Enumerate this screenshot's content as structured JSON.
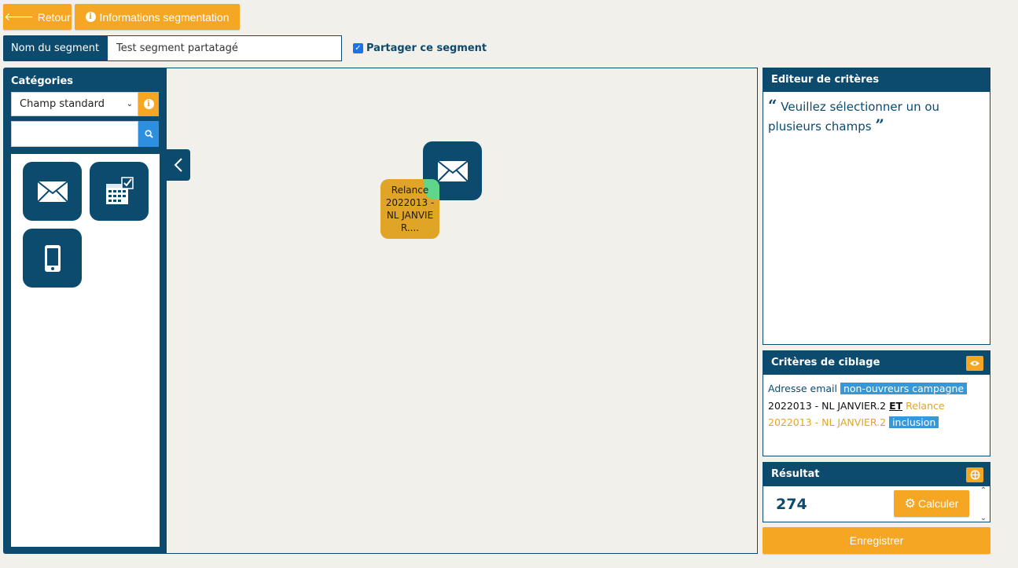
{
  "toolbar": {
    "back_label": "Retour",
    "info_label": "Informations segmentation"
  },
  "segment": {
    "name_label": "Nom du segment",
    "name_value": "Test segment partatagé",
    "share_label": "Partager ce segment",
    "share_checked": true
  },
  "sidebar": {
    "title": "Catégories",
    "select_value": "Champ standard",
    "search_placeholder": "",
    "tiles": [
      {
        "icon": "envelope-icon"
      },
      {
        "icon": "calendar-check-icon"
      },
      {
        "icon": "mobile-phone-icon"
      }
    ]
  },
  "canvas": {
    "email_node_icon": "envelope-icon",
    "campaign_node_label": "Relance 2022013 - NL JANVIE R...."
  },
  "criteria_editor": {
    "title": "Editeur de critères",
    "placeholder": "Veuillez sélectionner un ou plusieurs champs"
  },
  "targeting": {
    "title": "Critères de ciblage",
    "line_prefix": "Adresse email",
    "tag1": "non-ouvreurs campagne",
    "text2": "2022013 - NL JANVIER.2",
    "operator": "ET",
    "orange_text": "Relance 2022013 - NL JANVIER.2",
    "tag2": "inclusion"
  },
  "result": {
    "title": "Résultat",
    "value": "274",
    "calc_label": "Calculer"
  },
  "save_label": "Enregistrer",
  "colors": {
    "navy": "#0c4a6e",
    "orange": "#f5a623",
    "tag_blue": "#3498db",
    "node_orange": "#e0a526",
    "node_green_dot": "#5fd68a"
  }
}
